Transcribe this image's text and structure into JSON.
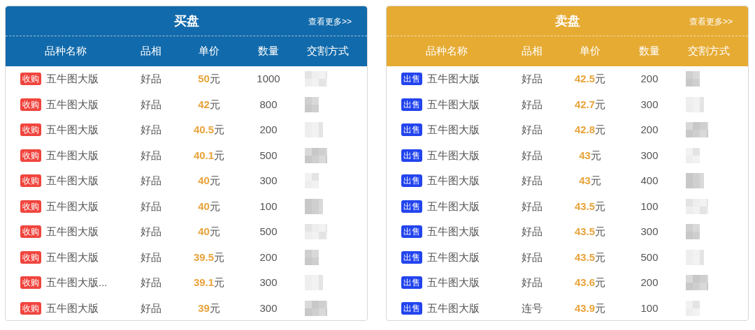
{
  "panels": [
    {
      "kind": "buy",
      "title": "买盘",
      "more_link": "查看更多>>",
      "columns": [
        "品种名称",
        "品相",
        "单价",
        "数量",
        "交割方式"
      ],
      "rows": [
        {
          "badge": "收购",
          "name": "五牛图大版",
          "grade": "好品",
          "price": "**50**元",
          "quantity": "1000"
        },
        {
          "badge": "收购",
          "name": "五牛图大版",
          "grade": "好品",
          "price": "**42**元",
          "quantity": "800"
        },
        {
          "badge": "收购",
          "name": "五牛图大版",
          "grade": "好品",
          "price": "**40.5**元",
          "quantity": "200"
        },
        {
          "badge": "收购",
          "name": "五牛图大版",
          "grade": "好品",
          "price": "**40.1**元",
          "quantity": "500"
        },
        {
          "badge": "收购",
          "name": "五牛图大版",
          "grade": "好品",
          "price": "**40**元",
          "quantity": "300"
        },
        {
          "badge": "收购",
          "name": "五牛图大版",
          "grade": "好品",
          "price": "**40**元",
          "quantity": "100"
        },
        {
          "badge": "收购",
          "name": "五牛图大版",
          "grade": "好品",
          "price": "**40**元",
          "quantity": "500"
        },
        {
          "badge": "收购",
          "name": "五牛图大版",
          "grade": "好品",
          "price": "**39.5**元",
          "quantity": "200"
        },
        {
          "badge": "收购",
          "name": "五牛图大版...",
          "grade": "好品",
          "price": "**39.1**元",
          "quantity": "300"
        },
        {
          "badge": "收购",
          "name": "五牛图大版",
          "grade": "好品",
          "price": "**39**元",
          "quantity": "300"
        }
      ]
    },
    {
      "kind": "sell",
      "title": "卖盘",
      "more_link": "查看更多>>",
      "columns": [
        "品种名称",
        "品相",
        "单价",
        "数量",
        "交割方式"
      ],
      "rows": [
        {
          "badge": "出售",
          "name": "五牛图大版",
          "grade": "好品",
          "price": "**42.5**元",
          "quantity": "200"
        },
        {
          "badge": "出售",
          "name": "五牛图大版",
          "grade": "好品",
          "price": "**42.7**元",
          "quantity": "300"
        },
        {
          "badge": "出售",
          "name": "五牛图大版",
          "grade": "好品",
          "price": "**42.8**元",
          "quantity": "200"
        },
        {
          "badge": "出售",
          "name": "五牛图大版",
          "grade": "好品",
          "price": "**43**元",
          "quantity": "300"
        },
        {
          "badge": "出售",
          "name": "五牛图大版",
          "grade": "好品",
          "price": "**43**元",
          "quantity": "400"
        },
        {
          "badge": "出售",
          "name": "五牛图大版",
          "grade": "好品",
          "price": "**43.5**元",
          "quantity": "100"
        },
        {
          "badge": "出售",
          "name": "五牛图大版",
          "grade": "好品",
          "price": "**43.5**元",
          "quantity": "300"
        },
        {
          "badge": "出售",
          "name": "五牛图大版",
          "grade": "好品",
          "price": "**43.5**元",
          "quantity": "500"
        },
        {
          "badge": "出售",
          "name": "五牛图大版",
          "grade": "好品",
          "price": "**43.6**元",
          "quantity": "200"
        },
        {
          "badge": "出售",
          "name": "五牛图大版",
          "grade": "连号",
          "price": "**43.9**元",
          "quantity": "100"
        }
      ]
    }
  ]
}
